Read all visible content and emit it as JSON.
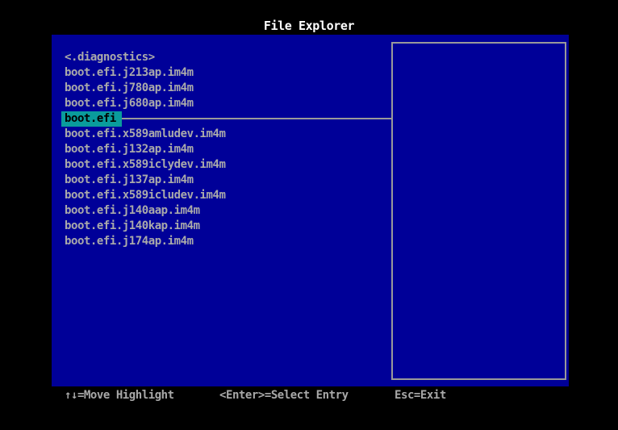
{
  "window": {
    "title": "File Explorer"
  },
  "colors": {
    "screen_background": "#000000",
    "panel_background": "#000098",
    "list_text": "#aaaaaa",
    "highlight_background": "#0a9c9c",
    "highlight_text": "#000000",
    "title_text": "#ffffff",
    "border_and_line": "#9a9a9a"
  },
  "file_list": {
    "items": [
      {
        "label": "<.diagnostics>",
        "selected": false
      },
      {
        "label": "boot.efi.j213ap.im4m",
        "selected": false
      },
      {
        "label": "boot.efi.j780ap.im4m",
        "selected": false
      },
      {
        "label": "boot.efi.j680ap.im4m",
        "selected": false
      },
      {
        "label": "boot.efi",
        "selected": true
      },
      {
        "label": "boot.efi.x589amludev.im4m",
        "selected": false
      },
      {
        "label": "boot.efi.j132ap.im4m",
        "selected": false
      },
      {
        "label": "boot.efi.x589iclydev.im4m",
        "selected": false
      },
      {
        "label": "boot.efi.j137ap.im4m",
        "selected": false
      },
      {
        "label": "boot.efi.x589icludev.im4m",
        "selected": false
      },
      {
        "label": "boot.efi.j140aap.im4m",
        "selected": false
      },
      {
        "label": "boot.efi.j140kap.im4m",
        "selected": false
      },
      {
        "label": "boot.efi.j174ap.im4m",
        "selected": false
      }
    ]
  },
  "help_panel": {
    "content": ""
  },
  "status_bar": {
    "move_hint": "↑↓=Move Highlight",
    "select_hint": "<Enter>=Select Entry",
    "exit_hint": "Esc=Exit"
  }
}
